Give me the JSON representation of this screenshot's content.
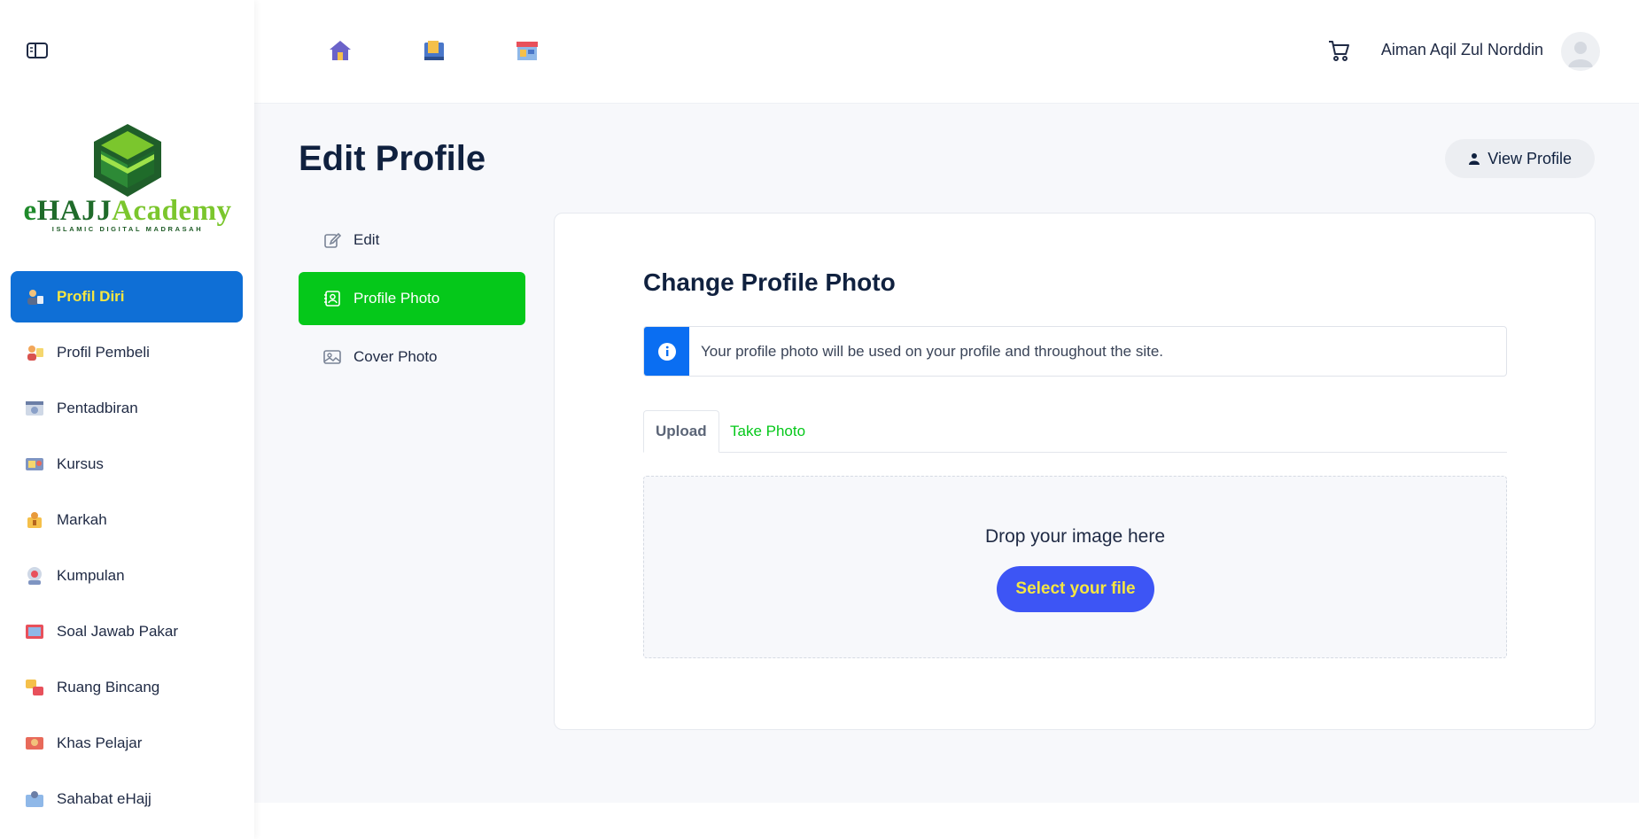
{
  "sidebar": {
    "toggle_icon": "sidebar-toggle-icon",
    "logo": {
      "text_e": "e",
      "text_hajj": "HAJJ",
      "text_academy": "Academy",
      "tagline": "ISLAMIC DIGITAL MADRASAH"
    },
    "items": [
      {
        "label": "Profil Diri",
        "icon": "profile-icon",
        "active": true
      },
      {
        "label": "Profil Pembeli",
        "icon": "buyer-icon"
      },
      {
        "label": "Pentadbiran",
        "icon": "admin-icon"
      },
      {
        "label": "Kursus",
        "icon": "course-icon"
      },
      {
        "label": "Markah",
        "icon": "marks-icon"
      },
      {
        "label": "Kumpulan",
        "icon": "group-icon"
      },
      {
        "label": "Soal Jawab Pakar",
        "icon": "qa-icon"
      },
      {
        "label": "Ruang Bincang",
        "icon": "discussion-icon"
      },
      {
        "label": "Khas Pelajar",
        "icon": "student-icon"
      },
      {
        "label": "Sahabat eHajj",
        "icon": "friends-icon"
      }
    ]
  },
  "header": {
    "icons": [
      "home-icon",
      "book-icon",
      "store-icon"
    ],
    "cart_icon": "cart-icon",
    "user_name": "Aiman Aqil Zul Norddin",
    "avatar_icon": "user-avatar-icon"
  },
  "page": {
    "title": "Edit Profile",
    "view_profile_label": "View Profile"
  },
  "subnav": {
    "items": [
      {
        "label": "Edit",
        "icon": "edit-icon"
      },
      {
        "label": "Profile Photo",
        "icon": "profile-photo-icon",
        "active": true
      },
      {
        "label": "Cover Photo",
        "icon": "cover-photo-icon"
      }
    ]
  },
  "card": {
    "title": "Change Profile Photo",
    "alert_text": "Your profile photo will be used on your profile and throughout the site.",
    "tabs": {
      "upload": "Upload",
      "take_photo": "Take Photo"
    },
    "drop_text": "Drop your image here",
    "select_label": "Select your file"
  },
  "colors": {
    "sidebar_active": "#0f6fd6",
    "sidebar_active_text": "#f5e642",
    "subnav_active": "#05c81a",
    "alert_icon_bg": "#0a6ef2",
    "button_primary": "#3d55f5"
  }
}
